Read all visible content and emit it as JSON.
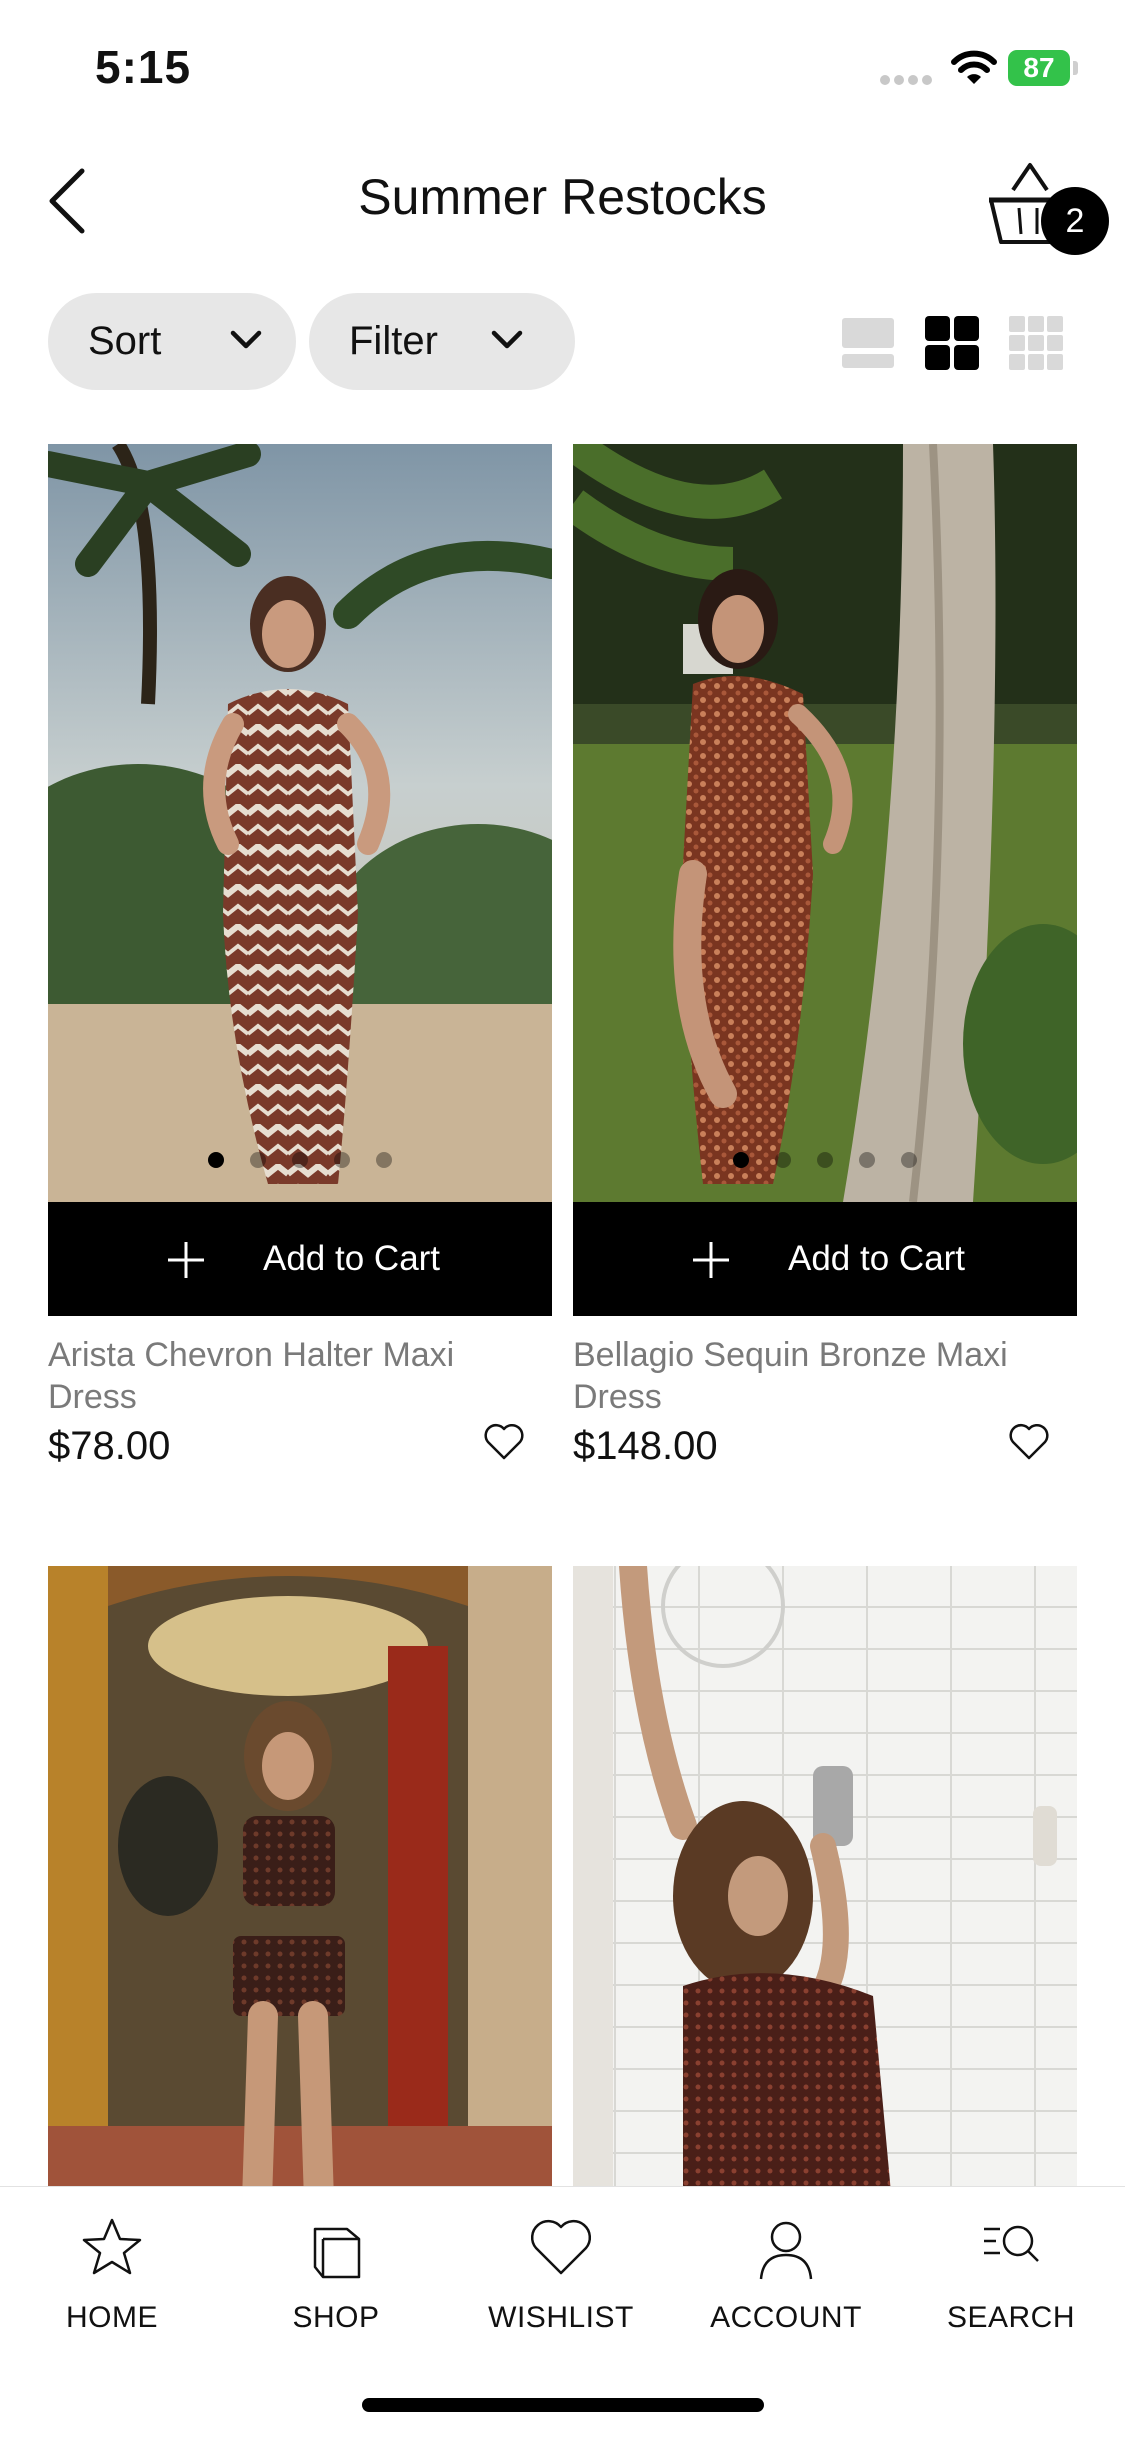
{
  "status_bar": {
    "time": "5:15",
    "battery": "87"
  },
  "header": {
    "title": "Summer Restocks",
    "cart_count": "2"
  },
  "toolbar": {
    "sort_label": "Sort",
    "filter_label": "Filter",
    "selected_view": "two-column-grid"
  },
  "products": [
    {
      "name": "Arista Chevron Halter Maxi Dress",
      "price": "$78.00",
      "add_label": "Add to Cart",
      "images": 5,
      "active_image": 1
    },
    {
      "name": "Bellagio Sequin Bronze Maxi Dress",
      "price": "$148.00",
      "add_label": "Add to Cart",
      "images": 5,
      "active_image": 1
    },
    {
      "name": "",
      "price": "",
      "add_label": ""
    },
    {
      "name": "",
      "price": "",
      "add_label": ""
    }
  ],
  "nav": {
    "items": [
      {
        "label": "HOME",
        "icon": "star-icon"
      },
      {
        "label": "SHOP",
        "icon": "shopping-bag-icon"
      },
      {
        "label": "WISHLIST",
        "icon": "heart-icon"
      },
      {
        "label": "ACCOUNT",
        "icon": "person-icon"
      },
      {
        "label": "SEARCH",
        "icon": "search-icon"
      }
    ]
  },
  "colors": {
    "accent": "#000000",
    "pill_bg": "#e7e7e7",
    "battery": "#33c24a",
    "muted_text": "#7a7a7a"
  }
}
